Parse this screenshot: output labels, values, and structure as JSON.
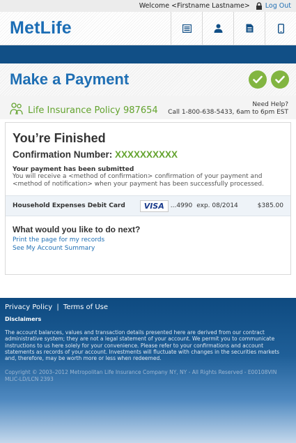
{
  "topbar": {
    "welcome": "Welcome <Firstname Lastname>",
    "logout": "Log Out"
  },
  "header": {
    "logo": "MetLife",
    "nav_icons": [
      "list-icon",
      "user-icon",
      "document-icon",
      "mobile-icon"
    ]
  },
  "page": {
    "title": "Make a Payment",
    "steps_complete": 2
  },
  "policy": {
    "label": "Life Insurance Policy 987654",
    "help_title": "Need Help?",
    "help_phone": "Call 1-800-638-5433, 6am to 6pm EST"
  },
  "result": {
    "heading": "You’re Finished",
    "confirmation_label": "Confirmation Number:",
    "confirmation_number": "XXXXXXXXXX",
    "submitted_title": "Your payment has been submitted",
    "submitted_message": "You will receive a <method of confirmation> confirmation of your payment and <method of notification> when your payment has been successfully processed."
  },
  "payment": {
    "account": "Household Expenses Debit Card",
    "card_brand": "VISA",
    "card_number": "...4990",
    "expiry": "exp. 08/2014",
    "amount": "$385.00"
  },
  "next_steps": {
    "title": "What would you like to do next?",
    "print_link": "Print the page for my records",
    "summary_link": "See My Account Summary"
  },
  "footer": {
    "privacy": "Privacy Policy",
    "separator": "|",
    "terms": "Terms of Use",
    "disclaimers_title": "Disclaimers",
    "disclaimer_text": "The account balances, values and transaction details presented here are derived from our contract administrative system; they are not a legal statement of your account. We permit you to communicate instructions to us here solely for your convenience. Please refer to your confirmations and account statements as records of your account. Investments will fluctuate with changes in the securities markets and, therefore, may be worth more or less when redeemed.",
    "copyright": "Copyright © 2003–2012 Metropolitan Life Insurance Company NY, NY - All Rights Reserved - E00108VIN MLIC-LD/LCN 2393"
  },
  "colors": {
    "brand_blue": "#1f6fb4",
    "navy": "#114f86",
    "green": "#82b541",
    "green_text": "#63a32e"
  }
}
